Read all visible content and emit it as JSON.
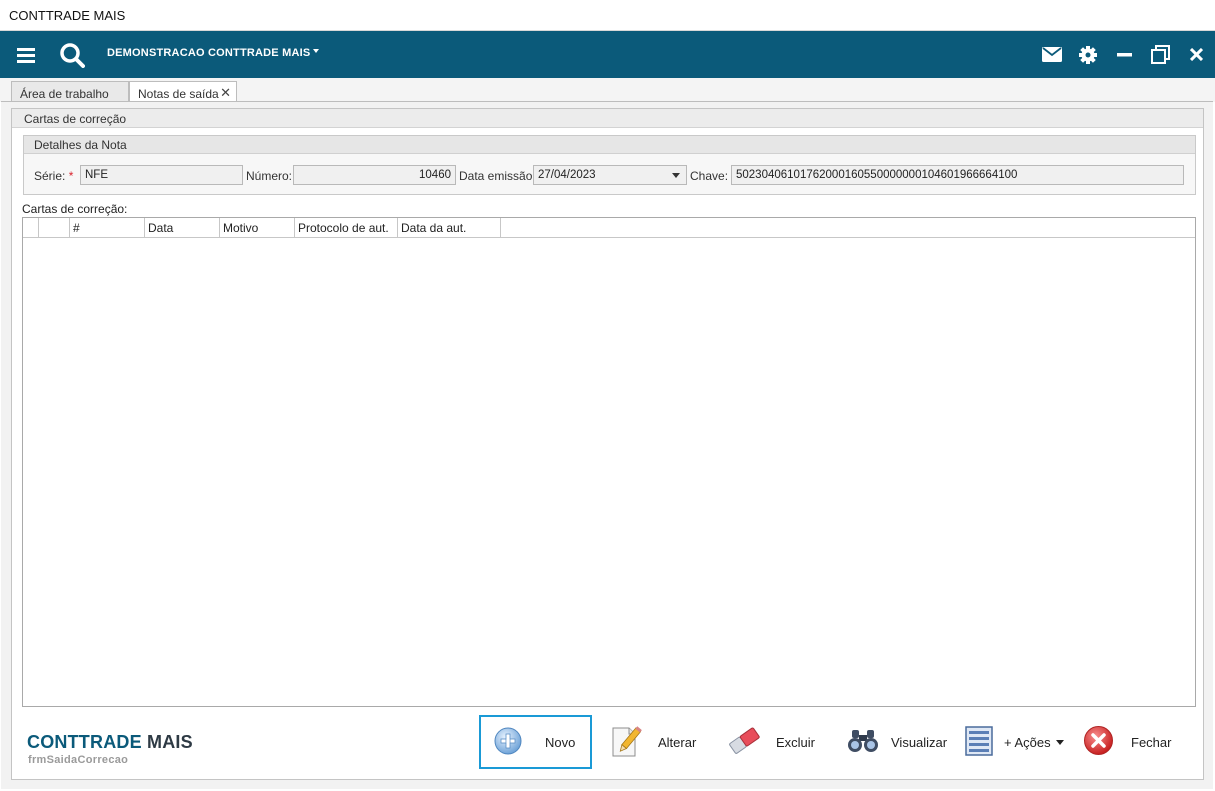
{
  "window": {
    "title": "CONTTRADE MAIS"
  },
  "topbar": {
    "company": "DEMONSTRACAO CONTTRADE MAIS",
    "icons": [
      "menu-icon",
      "search-icon",
      "mail-icon",
      "gear-icon",
      "minimize-icon",
      "restore-icon",
      "close-icon"
    ]
  },
  "tabs": [
    {
      "label": "Área de trabalho",
      "active": false
    },
    {
      "label": "Notas de saída",
      "active": true,
      "closable": true
    }
  ],
  "panel": {
    "title": "Cartas de correção",
    "details": {
      "title": "Detalhes da Nota",
      "serie_label": "Série:",
      "required_mark": "*",
      "serie_value": "NFE",
      "numero_label": "Número:",
      "numero_value": "10460",
      "data_label": "Data emissão:",
      "data_value": "27/04/2023",
      "chave_label": "Chave:",
      "chave_value": "50230406101762000160550000000104601966664100"
    },
    "list_label": "Cartas de correção:",
    "columns": [
      "",
      "",
      "#",
      "Data",
      "Motivo",
      "Protocolo de aut.",
      "Data da aut."
    ],
    "rows": []
  },
  "footer": {
    "brand_main": "CONTTRADE",
    "brand_suffix": " MAIS",
    "form_name": "frmSaidaCorrecao",
    "buttons": {
      "novo": "Novo",
      "alterar": "Alterar",
      "excluir": "Excluir",
      "visualizar": "Visualizar",
      "acoes": "+ Ações",
      "fechar": "Fechar"
    }
  },
  "colors": {
    "topbar": "#0b5a7a",
    "focus": "#1a9ad6",
    "required": "#d9232e"
  }
}
